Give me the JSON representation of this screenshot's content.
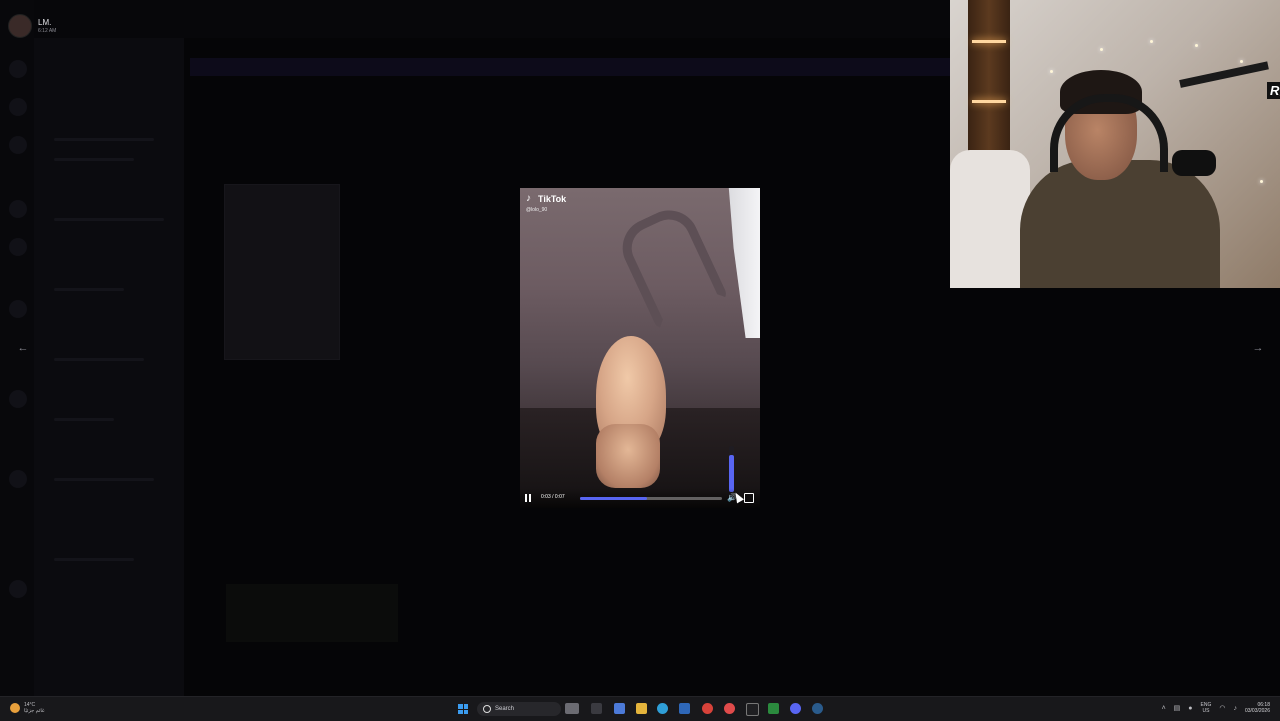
{
  "user": {
    "name": "LM.",
    "status_time": "6:12 AM"
  },
  "video": {
    "source_label": "TikTok",
    "handle": "@lolo_90",
    "time_display": "0:03 / 0:07",
    "progress": 0.47,
    "volume": 0.8,
    "accent_color": "#5865f2"
  },
  "nav": {
    "prev_icon": "←",
    "next_icon": "→"
  },
  "webcam": {
    "brand_text": "RØ"
  },
  "taskbar": {
    "weather_temp": "14°C",
    "weather_desc": "غائم جزئيًا",
    "search_placeholder": "Search",
    "lang_top": "ENG",
    "lang_bottom": "US",
    "time": "06:18",
    "date": "03/03/2026",
    "apps": [
      "file-explorer-icon",
      "edge-icon",
      "chrome-icon",
      "opera-icon",
      "obs-icon",
      "discord-icon",
      "steam-icon"
    ]
  }
}
